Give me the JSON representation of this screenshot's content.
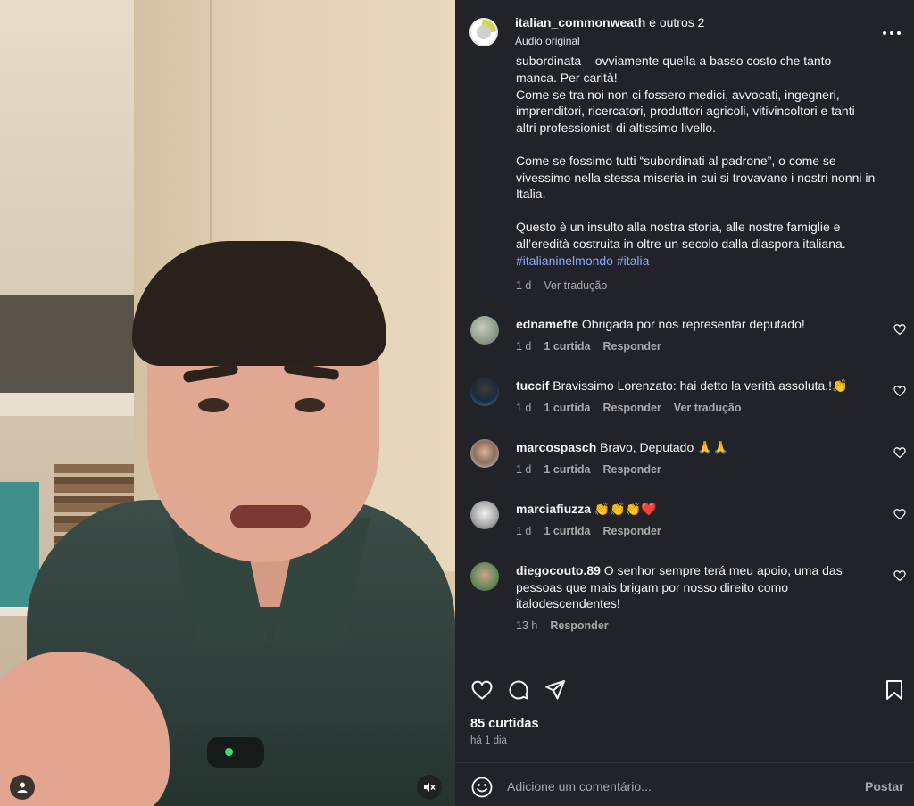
{
  "post": {
    "author_line": "italian_commonweath",
    "coauthors": " e outros 2",
    "audio": "Áudio original"
  },
  "caption": {
    "cut_line": "subordinata – ovviamente quella a basso costo che tanto",
    "para1_l1": "manca. Per carità!",
    "para1_l2": "Come se tra noi non ci fossero medici, avvocati, ingegneri,",
    "para1_l3": "imprenditori, ricercatori, produttori agricoli, vitivincoltori e tanti",
    "para1_l4": "altri professionisti di altissimo livello.",
    "para2_l1": "Come se fossimo tutti “subordinati al padrone”, o come se",
    "para2_l2": "vivessimo nella stessa miseria in cui si trovavano i nostri nonni in",
    "para2_l3": "Italia.",
    "para3_l1": "Questo è un insulto alla nostra storia, alle nostre famiglie e",
    "para3_l2": "all’eredità costruita in oltre un secolo dalla diaspora italiana.",
    "hashtag1": "#italianinelmondo",
    "hashtag2": "#italia",
    "time": "1 d",
    "translate": "Ver tradução"
  },
  "comments": [
    {
      "user": "ednameffe",
      "text": " Obrigada por nos representar deputado!",
      "time": "1 d",
      "likes": "1 curtida",
      "reply": "Responder"
    },
    {
      "user": "tuccif",
      "text": " Bravissimo Lorenzato: hai detto la verità assoluta.!👏",
      "time": "1 d",
      "likes": "1 curtida",
      "reply": "Responder",
      "translate": "Ver tradução"
    },
    {
      "user": "marcospasch",
      "text": " Bravo, Deputado 🙏🙏",
      "time": "1 d",
      "likes": "1 curtida",
      "reply": "Responder"
    },
    {
      "user": "marciafiuzza",
      "text": " 👏👏👏❤️",
      "time": "1 d",
      "likes": "1 curtida",
      "reply": "Responder"
    },
    {
      "user": "diegocouto.89",
      "text_l1": " O senhor sempre terá meu apoio, uma das",
      "text_l2": "pessoas que mais brigam por nosso direito como",
      "text_l3": "italodescendentes!",
      "time": "13 h",
      "reply": "Responder"
    }
  ],
  "footer": {
    "likes": "85 curtidas",
    "when": "há 1 dia",
    "comment_placeholder": "Adicione um comentário...",
    "post_button": "Postar"
  },
  "icons": {
    "like": "heart-icon",
    "comment": "comment-icon",
    "share": "share-icon",
    "save": "bookmark-icon",
    "more": "more-icon",
    "emoji": "emoji-icon",
    "mute": "muted-icon",
    "tagged": "user-icon"
  },
  "colors": {
    "panel_bg": "#212328",
    "hashtag": "#8ea8ff",
    "muted_text": "#a8a8a8"
  }
}
